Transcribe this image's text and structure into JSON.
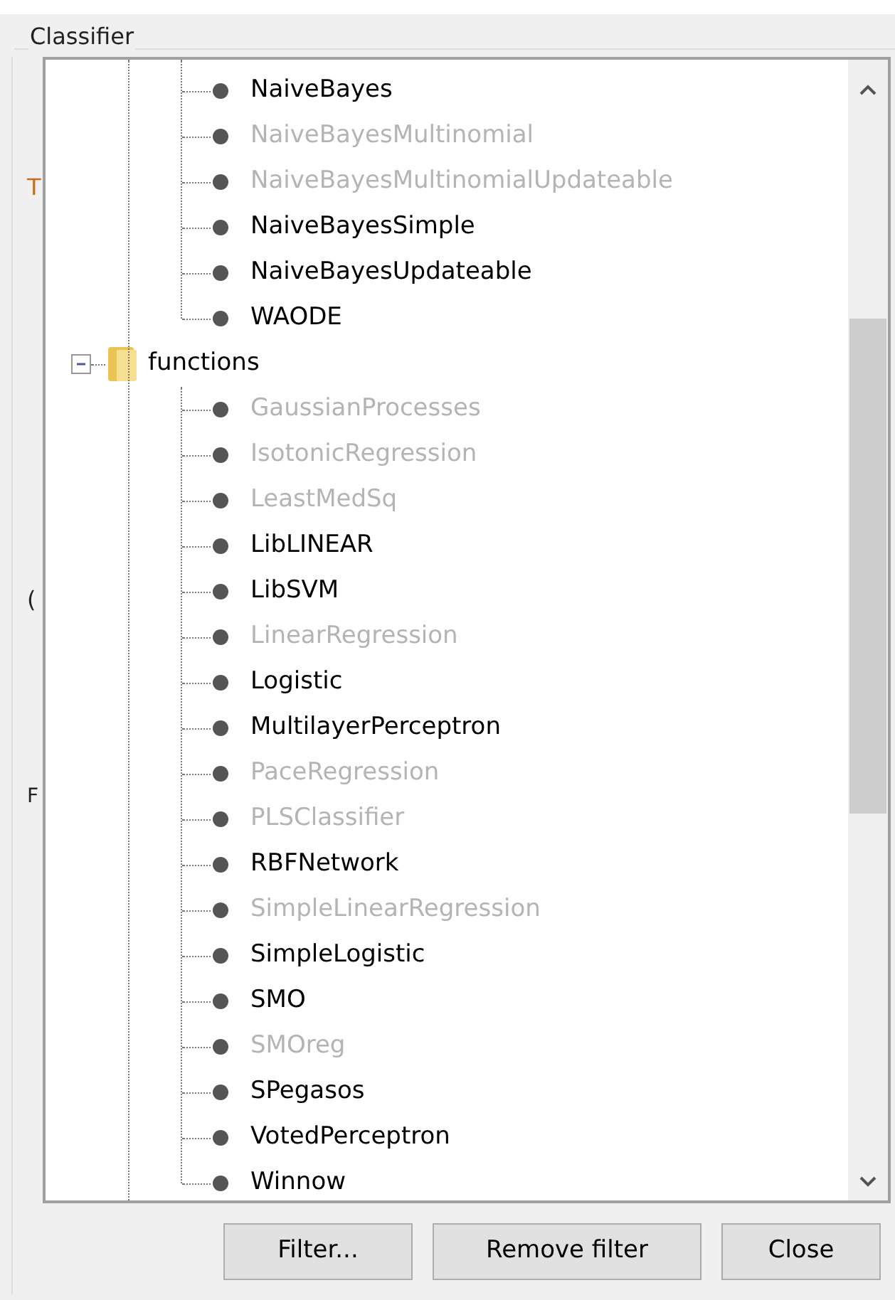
{
  "group_title": "Classifier",
  "background_fragments": [
    "T",
    "(",
    "F"
  ],
  "tree": {
    "upper_children": [
      {
        "label": "NaiveBayes",
        "disabled": false
      },
      {
        "label": "NaiveBayesMultinomial",
        "disabled": true
      },
      {
        "label": "NaiveBayesMultinomialUpdateable",
        "disabled": true
      },
      {
        "label": "NaiveBayesSimple",
        "disabled": false
      },
      {
        "label": "NaiveBayesUpdateable",
        "disabled": false
      },
      {
        "label": "WAODE",
        "disabled": false
      }
    ],
    "folders": [
      {
        "label": "functions",
        "expanded": true,
        "children": [
          {
            "label": "GaussianProcesses",
            "disabled": true
          },
          {
            "label": "IsotonicRegression",
            "disabled": true
          },
          {
            "label": "LeastMedSq",
            "disabled": true
          },
          {
            "label": "LibLINEAR",
            "disabled": false
          },
          {
            "label": "LibSVM",
            "disabled": false
          },
          {
            "label": "LinearRegression",
            "disabled": true
          },
          {
            "label": "Logistic",
            "disabled": false
          },
          {
            "label": "MultilayerPerceptron",
            "disabled": false
          },
          {
            "label": "PaceRegression",
            "disabled": true
          },
          {
            "label": "PLSClassifier",
            "disabled": true
          },
          {
            "label": "RBFNetwork",
            "disabled": false
          },
          {
            "label": "SimpleLinearRegression",
            "disabled": true
          },
          {
            "label": "SimpleLogistic",
            "disabled": false
          },
          {
            "label": "SMO",
            "disabled": false
          },
          {
            "label": "SMOreg",
            "disabled": true
          },
          {
            "label": "SPegasos",
            "disabled": false
          },
          {
            "label": "VotedPerceptron",
            "disabled": false
          },
          {
            "label": "Winnow",
            "disabled": false
          }
        ]
      }
    ]
  },
  "buttons": [
    "Filter...",
    "Remove filter",
    "Close"
  ]
}
